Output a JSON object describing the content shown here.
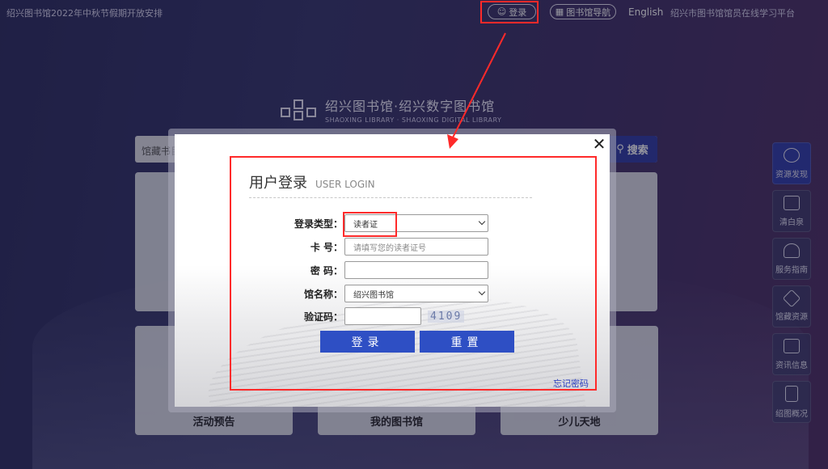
{
  "topbar": {
    "notice": "绍兴图书馆2022年中秋节假期开放安排",
    "login_label": "登录",
    "guide_label": "图书馆导航",
    "english_label": "English",
    "platform_label": "绍兴市图书馆馆员在线学习平台"
  },
  "logo": {
    "cn": "绍兴图书馆·绍兴数字图书馆",
    "en": "SHAOXING LIBRARY · SHAOXING DIGITAL LIBRARY"
  },
  "search": {
    "placeholder": "馆藏书目",
    "button_label": "搜索"
  },
  "panels": [
    {
      "label": "活动预告"
    },
    {
      "label": "我的图书馆"
    },
    {
      "label": "少儿天地"
    }
  ],
  "sidemenu": [
    {
      "label": "资源发现",
      "icon": "compass-icon"
    },
    {
      "label": "清白泉",
      "icon": "document-icon"
    },
    {
      "label": "服务指南",
      "icon": "headset-icon"
    },
    {
      "label": "馆藏资源",
      "icon": "layers-icon"
    },
    {
      "label": "资讯信息",
      "icon": "news-icon"
    },
    {
      "label": "绍图概况",
      "icon": "building-icon"
    }
  ],
  "modal": {
    "close_glyph": "✕",
    "title_cn": "用户登录",
    "title_en": "USER LOGIN",
    "fields": {
      "type_label": "登录类型：",
      "type_value": "读者证",
      "card_label": "卡 号：",
      "card_placeholder": "请填写您的读者证号",
      "password_label": "密 码：",
      "password_value": "",
      "library_label": "馆名称：",
      "library_value": "绍兴图书馆",
      "captcha_label": "验证码：",
      "captcha_value": "",
      "captcha_image_text": "4109"
    },
    "login_button": "登录",
    "reset_button": "重置",
    "forgot_link": "忘记密码"
  },
  "colors": {
    "accent_blue": "#2e4fc4",
    "annotation_red": "#ff2a2a"
  }
}
